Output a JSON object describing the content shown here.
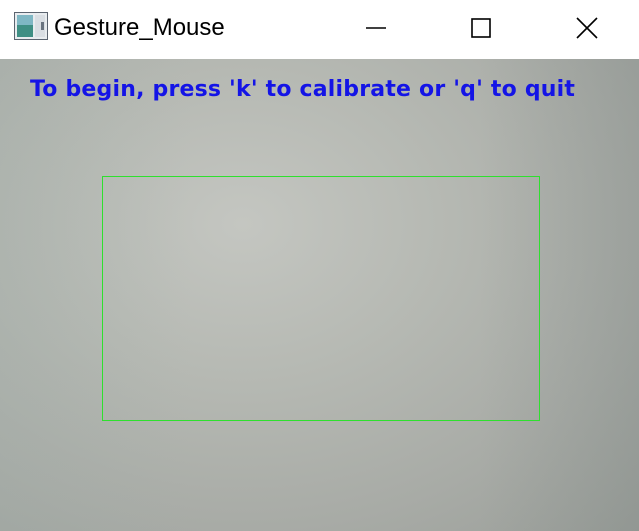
{
  "window": {
    "title": "Gesture_Mouse",
    "controls": {
      "minimize": "minimize-icon",
      "maximize": "maximize-icon",
      "close": "close-icon"
    }
  },
  "feed": {
    "instruction": "To begin, press 'k' to calibrate or 'q' to quit",
    "instruction_color": "#1414e6",
    "roi_color": "#2ee02e"
  }
}
